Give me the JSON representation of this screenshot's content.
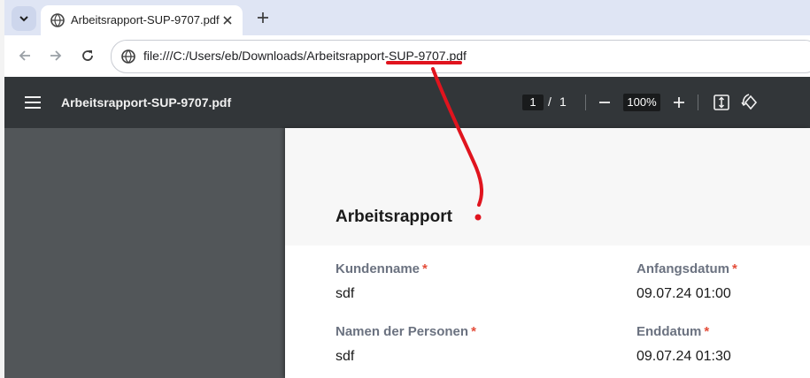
{
  "browser": {
    "tab": {
      "title": "Arbeitsrapport-SUP-9707.pdf"
    },
    "address_bar": {
      "url": "file:///C:/Users/eb/Downloads/Arbeitsrapport-SUP-9707.pdf"
    }
  },
  "pdf_viewer": {
    "title": "Arbeitsrapport-SUP-9707.pdf",
    "current_page": "1",
    "page_separator": "/",
    "total_pages": "1",
    "zoom": "100%"
  },
  "document": {
    "title": "Arbeitsrapport",
    "fields": [
      {
        "label": "Kundenname",
        "required_mark": "*",
        "value": "sdf"
      },
      {
        "label": "Anfangsdatum",
        "required_mark": "*",
        "value": "09.07.24 01:00"
      },
      {
        "label": "Namen der Personen",
        "required_mark": "*",
        "value": "sdf"
      },
      {
        "label": "Enddatum",
        "required_mark": "*",
        "value": "09.07.24 01:30"
      }
    ]
  },
  "colors": {
    "tabstrip": "#dfe5f4",
    "pdf_toolbar": "#323639",
    "viewer_background": "#525659",
    "required_asterisk": "#e44d3a",
    "annotation": "#e0141e"
  }
}
